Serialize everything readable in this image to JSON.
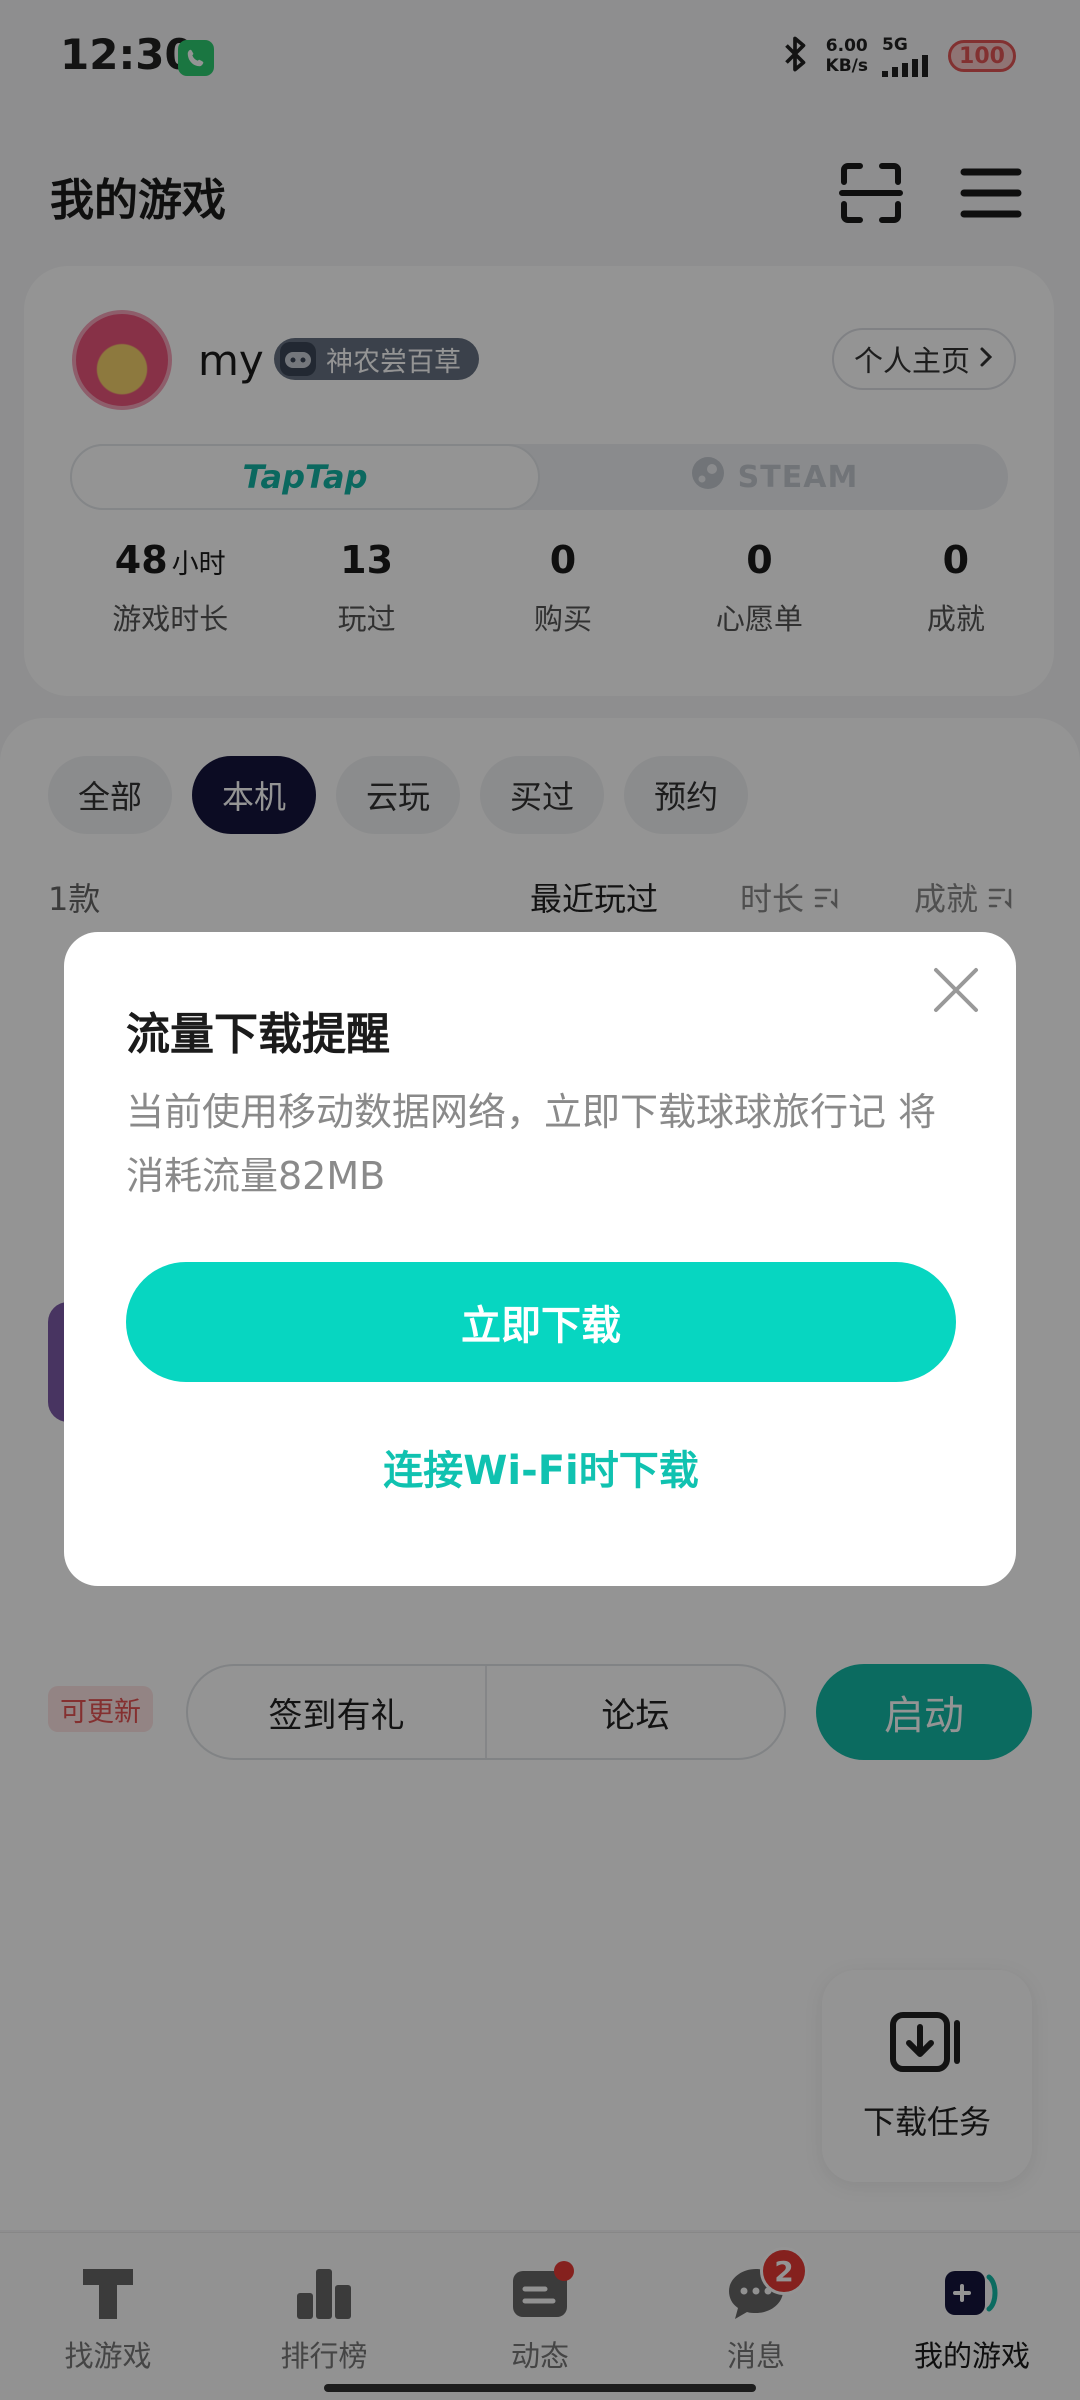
{
  "status_bar": {
    "time": "12:30",
    "net_speed_value": "6.00",
    "net_speed_unit": "KB/s",
    "network": "5G",
    "battery": "100"
  },
  "header": {
    "title": "我的游戏",
    "icons": [
      "scan-icon",
      "menu-icon"
    ]
  },
  "profile": {
    "username": "my",
    "badge": "神农尝百草",
    "profile_button": "个人主页",
    "platforms": {
      "taptap": "TapTap",
      "steam": "STEAM"
    },
    "stats": [
      {
        "value": "48",
        "unit": "小时",
        "label": "游戏时长"
      },
      {
        "value": "13",
        "unit": "",
        "label": "玩过"
      },
      {
        "value": "0",
        "unit": "",
        "label": "购买"
      },
      {
        "value": "0",
        "unit": "",
        "label": "心愿单"
      },
      {
        "value": "0",
        "unit": "",
        "label": "成就"
      }
    ]
  },
  "filters": {
    "tabs": [
      "全部",
      "本机",
      "云玩",
      "买过",
      "预约"
    ],
    "active": "本机"
  },
  "list": {
    "count": "1款",
    "sort_options": [
      "最近玩过",
      "时长",
      "成就"
    ],
    "update_tag": "可更新",
    "actions": [
      "签到有礼",
      "论坛"
    ],
    "launch": "启动"
  },
  "download_task": {
    "label": "下载任务"
  },
  "bottom_nav": [
    {
      "label": "找游戏",
      "icon": "find-game-icon"
    },
    {
      "label": "排行榜",
      "icon": "ranking-icon"
    },
    {
      "label": "动态",
      "icon": "feed-icon"
    },
    {
      "label": "消息",
      "icon": "message-icon",
      "badge": "2"
    },
    {
      "label": "我的游戏",
      "icon": "my-games-icon"
    }
  ],
  "dialog": {
    "title": "流量下载提醒",
    "body": "当前使用移动数据网络，立即下载球球旅行记 将消耗流量82MB",
    "primary": "立即下载",
    "secondary": "连接Wi-Fi时下载"
  },
  "colors": {
    "accent": "#07d6c1",
    "launch": "#14b8a6",
    "active_tab": "#15163d",
    "badge_red": "#e53935"
  }
}
